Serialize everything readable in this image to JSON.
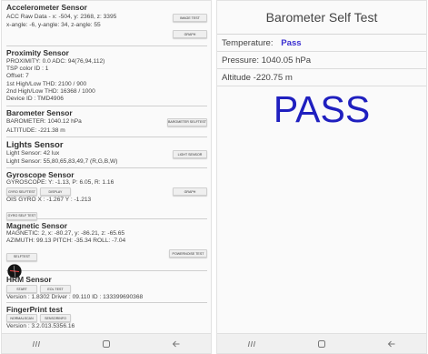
{
  "left": {
    "accelerometer": {
      "title": "Accelerometer Sensor",
      "line1": "ACC Raw Data - x: -504, y: 2368, z: 3395",
      "line2": "x-angle: -6, y-angle: 34, z-angle: 55",
      "btn_image_test": "IMAGE TEST",
      "btn_graph": "GRAPH"
    },
    "proximity": {
      "title": "Proximity Sensor",
      "lines": [
        "PROXIMITY: 0.0     ADC: 94(76,94,112)",
        "TSP color ID : 1",
        "Offset: 7",
        "1st High/Low THD: 2100 / 900",
        "2nd High/Low THD: 16368 / 1000",
        "Device ID : TMD4906"
      ]
    },
    "barometer": {
      "title": "Barometer Sensor",
      "line1": "BAROMETER: 1040.12 hPa",
      "btn_selftest": "BAROMETER SELFTEST",
      "line2": "ALTITUDE: -221.38 m"
    },
    "lights": {
      "title": "Lights Sensor",
      "line1": "Light Sensor: 42 lux",
      "btn": "LIGHT SENSOR",
      "line2": "Light Sensor: 55,80,65,83,49,7 (R,G,B,W)"
    },
    "gyroscope": {
      "title": "Gyroscope Sensor",
      "line1": "GYROSCOPE: Y: -1.13, P: 6.05, R: 1.16",
      "btn_selftest": "GYRO SELFTEST",
      "btn_display": "DISPLAY",
      "btn_graph": "GRAPH",
      "line2": "OIS GYRO  X : -1.267 Y : -1.213",
      "btn_gyro_self": "GYRO SELF TEST"
    },
    "magnetic": {
      "title": "Magnetic Sensor",
      "line1": "MAGNETIC: 2, x: -80.27, y: -86.21, z: -65.65",
      "line2": "AZIMUTH: 99.13   PITCH: -35.34   ROLL: -7.04",
      "btn_selftest": "SELFTEST",
      "btn_powernoise": "POWERNOISE TEST"
    },
    "hrm": {
      "title": "HRM Sensor",
      "btn_start": "START",
      "btn_eol": "EOL TEST",
      "line1": "Version : 1.8302   Driver : 09.110   ID : 133399690368"
    },
    "fingerprint": {
      "title": "FingerPrint test",
      "btn_normal": "NORMALSCAN",
      "btn_sensor": "SENSORINFO",
      "line1": "Version : 3.2.013.5356.16"
    },
    "nav": {
      "recent": "recent-apps-icon",
      "home": "home-icon",
      "back": "back-icon"
    }
  },
  "right": {
    "title": "Barometer Self Test",
    "temperature_label": "Temperature:",
    "temperature_value": "Pass",
    "pressure": "Pressure:  1040.05 hPa",
    "altitude": "Altitude  -220.75 m",
    "result": "PASS",
    "colors": {
      "pass_text": "#1f1fbf"
    }
  }
}
